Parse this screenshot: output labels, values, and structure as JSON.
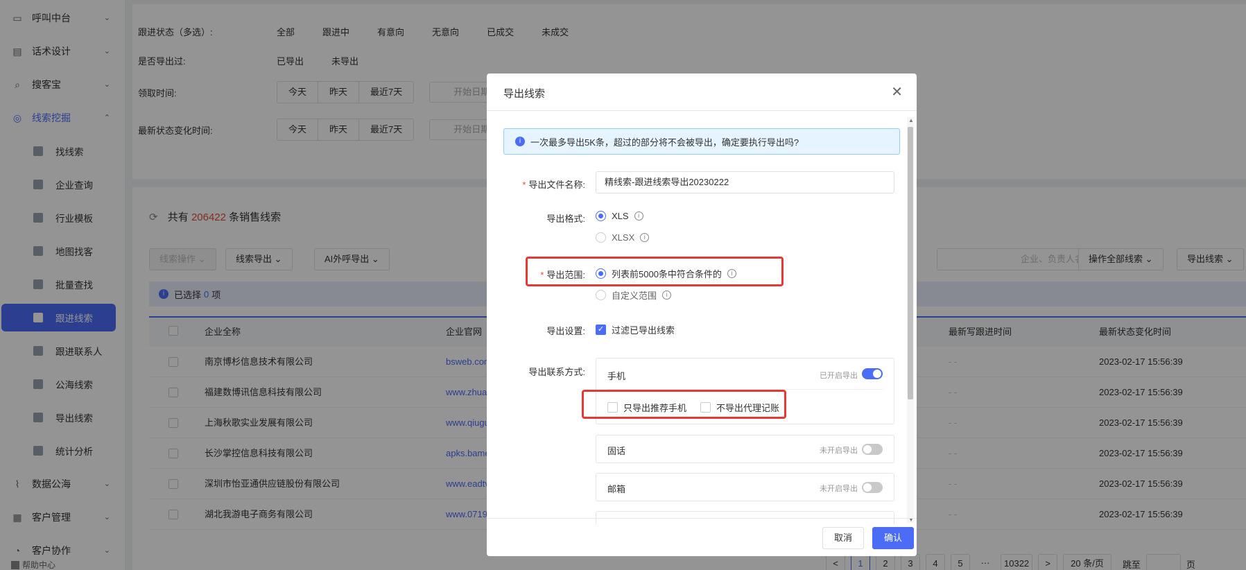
{
  "sidebar": {
    "top_items": [
      {
        "label": "呼叫中台",
        "icon": "monitor-icon"
      },
      {
        "label": "话术设计",
        "icon": "script-icon"
      },
      {
        "label": "搜客宝",
        "icon": "search-customer-icon"
      },
      {
        "label": "线索挖掘",
        "icon": "target-icon"
      }
    ],
    "sub_items": [
      {
        "label": "找线索"
      },
      {
        "label": "企业查询"
      },
      {
        "label": "行业模板"
      },
      {
        "label": "地图找客"
      },
      {
        "label": "批量查找"
      },
      {
        "label": "跟进线索"
      },
      {
        "label": "跟进联系人"
      },
      {
        "label": "公海线索"
      },
      {
        "label": "导出线索"
      },
      {
        "label": "统计分析"
      }
    ],
    "bottom_items": [
      {
        "label": "数据公海",
        "icon": "chart-icon"
      },
      {
        "label": "客户管理",
        "icon": "customer-icon"
      },
      {
        "label": "客户协作",
        "icon": "collab-icon"
      }
    ],
    "help": "帮助中心"
  },
  "filters": {
    "status_label": "跟进状态（多选）:",
    "status_options": [
      "全部",
      "跟进中",
      "有意向",
      "无意向",
      "已成交",
      "未成交"
    ],
    "exported_label": "是否导出过:",
    "exported_options": [
      "已导出",
      "未导出"
    ],
    "claim_time_label": "领取时间:",
    "status_change_label": "最新状态变化时间:",
    "quick_dates": [
      "今天",
      "昨天",
      "最近7天"
    ],
    "start_date_placeholder": "开始日期"
  },
  "list": {
    "title_prefix": "共有",
    "total": "206422",
    "title_suffix": "条销售线索",
    "toolbar": {
      "lead_ops": "线索操作",
      "lead_export": "线索导出",
      "ai_call_export": "AI外呼导出",
      "search_placeholder": "企业、负责人名称",
      "all_ops": "操作全部线索",
      "export_leads": "导出线索"
    },
    "selected_prefix": "已选择",
    "selected_count": "0",
    "selected_suffix": "项",
    "columns": [
      "企业全称",
      "企业官网",
      "最新写跟进时间",
      "最新状态变化时间"
    ],
    "rows": [
      {
        "name": "南京博杉信息技术有限公司",
        "site": "bsweb.com",
        "follow": "- -",
        "changed": "2023-02-17 15:56:39"
      },
      {
        "name": "福建数博讯信息科技有限公司",
        "site": "www.zhua",
        "follow": "- -",
        "changed": "2023-02-17 15:56:39"
      },
      {
        "name": "上海秋歌实业发展有限公司",
        "site": "www.qiugu",
        "follow": "- -",
        "changed": "2023-02-17 15:56:39"
      },
      {
        "name": "长沙掌控信息科技有限公司",
        "site": "apks.bame",
        "follow": "- -",
        "changed": "2023-02-17 15:56:39"
      },
      {
        "name": "深圳市怡亚通供应链股份有限公司",
        "site": "www.eadtv",
        "follow": "- -",
        "changed": "2023-02-17 15:56:39"
      },
      {
        "name": "湖北我游电子商务有限公司",
        "site": "www.0719",
        "follow": "- -",
        "changed": "2023-02-17 15:56:39"
      }
    ],
    "pager": {
      "prev": "<",
      "pages": [
        "1",
        "2",
        "3",
        "4",
        "5",
        "···",
        "10322"
      ],
      "next": ">",
      "page_size": "20 条/页",
      "goto": "跳至",
      "page_unit": "页"
    }
  },
  "dialog": {
    "title": "导出线索",
    "alert": "一次最多导出5K条，超过的部分将不会被导出，确定要执行导出吗?",
    "filename_label": "导出文件名称:",
    "filename_value": "精线索-跟进线索导出20230222",
    "format_label": "导出格式:",
    "format_options": [
      "XLS",
      "XLSX"
    ],
    "range_label": "导出范围:",
    "range_options": [
      "列表前5000条中符合条件的",
      "自定义范围"
    ],
    "settings_label": "导出设置:",
    "settings_option": "过滤已导出线索",
    "contact_label": "导出联系方式:",
    "contacts": [
      {
        "name": "手机",
        "status": "已开启导出",
        "enabled": true
      },
      {
        "name": "固话",
        "status": "未开启导出",
        "enabled": false
      },
      {
        "name": "邮箱",
        "status": "未开启导出",
        "enabled": false
      }
    ],
    "phone_options": [
      "只导出推荐手机",
      "不导出代理记账"
    ],
    "cancel": "取消",
    "confirm": "确认"
  }
}
